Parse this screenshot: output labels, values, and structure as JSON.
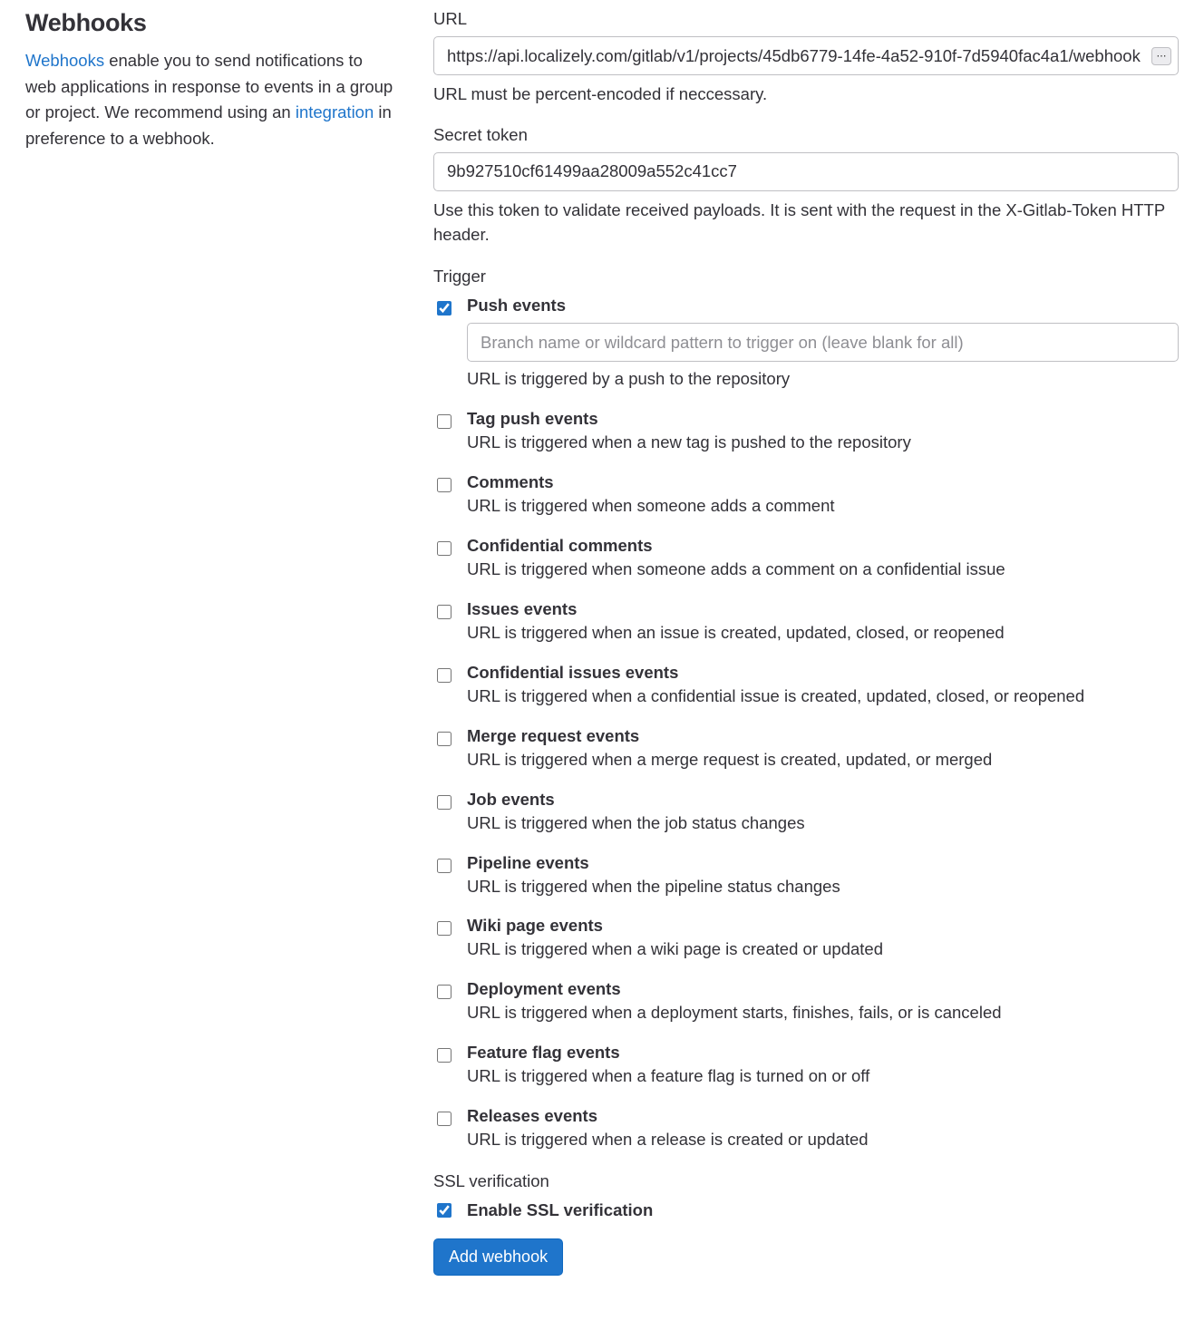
{
  "sidebar": {
    "title": "Webhooks",
    "link1_text": "Webhooks",
    "desc_part1": " enable you to send notifications to web applications in response to events in a group or project. We recommend using an ",
    "link2_text": "integration",
    "desc_part2": " in preference to a webhook."
  },
  "url": {
    "label": "URL",
    "value": "https://api.localizely.com/gitlab/v1/projects/45db6779-14fe-4a52-910f-7d5940fac4a1/webhook",
    "helper": "URL must be percent-encoded if neccessary."
  },
  "secret": {
    "label": "Secret token",
    "value": "9b927510cf61499aa28009a552c41cc7",
    "helper": "Use this token to validate received payloads. It is sent with the request in the X-Gitlab-Token HTTP header."
  },
  "trigger": {
    "label": "Trigger",
    "push": {
      "title": "Push events",
      "branch_placeholder": "Branch name or wildcard pattern to trigger on (leave blank for all)",
      "desc": "URL is triggered by a push to the repository",
      "checked": true
    },
    "items": [
      {
        "title": "Tag push events",
        "desc": "URL is triggered when a new tag is pushed to the repository",
        "checked": false
      },
      {
        "title": "Comments",
        "desc": "URL is triggered when someone adds a comment",
        "checked": false
      },
      {
        "title": "Confidential comments",
        "desc": "URL is triggered when someone adds a comment on a confidential issue",
        "checked": false
      },
      {
        "title": "Issues events",
        "desc": "URL is triggered when an issue is created, updated, closed, or reopened",
        "checked": false
      },
      {
        "title": "Confidential issues events",
        "desc": "URL is triggered when a confidential issue is created, updated, closed, or reopened",
        "checked": false
      },
      {
        "title": "Merge request events",
        "desc": "URL is triggered when a merge request is created, updated, or merged",
        "checked": false
      },
      {
        "title": "Job events",
        "desc": "URL is triggered when the job status changes",
        "checked": false
      },
      {
        "title": "Pipeline events",
        "desc": "URL is triggered when the pipeline status changes",
        "checked": false
      },
      {
        "title": "Wiki page events",
        "desc": "URL is triggered when a wiki page is created or updated",
        "checked": false
      },
      {
        "title": "Deployment events",
        "desc": "URL is triggered when a deployment starts, finishes, fails, or is canceled",
        "checked": false
      },
      {
        "title": "Feature flag events",
        "desc": "URL is triggered when a feature flag is turned on or off",
        "checked": false
      },
      {
        "title": "Releases events",
        "desc": "URL is triggered when a release is created or updated",
        "checked": false
      }
    ]
  },
  "ssl": {
    "label": "SSL verification",
    "checkbox_label": "Enable SSL verification",
    "checked": true
  },
  "submit": {
    "label": "Add webhook"
  }
}
